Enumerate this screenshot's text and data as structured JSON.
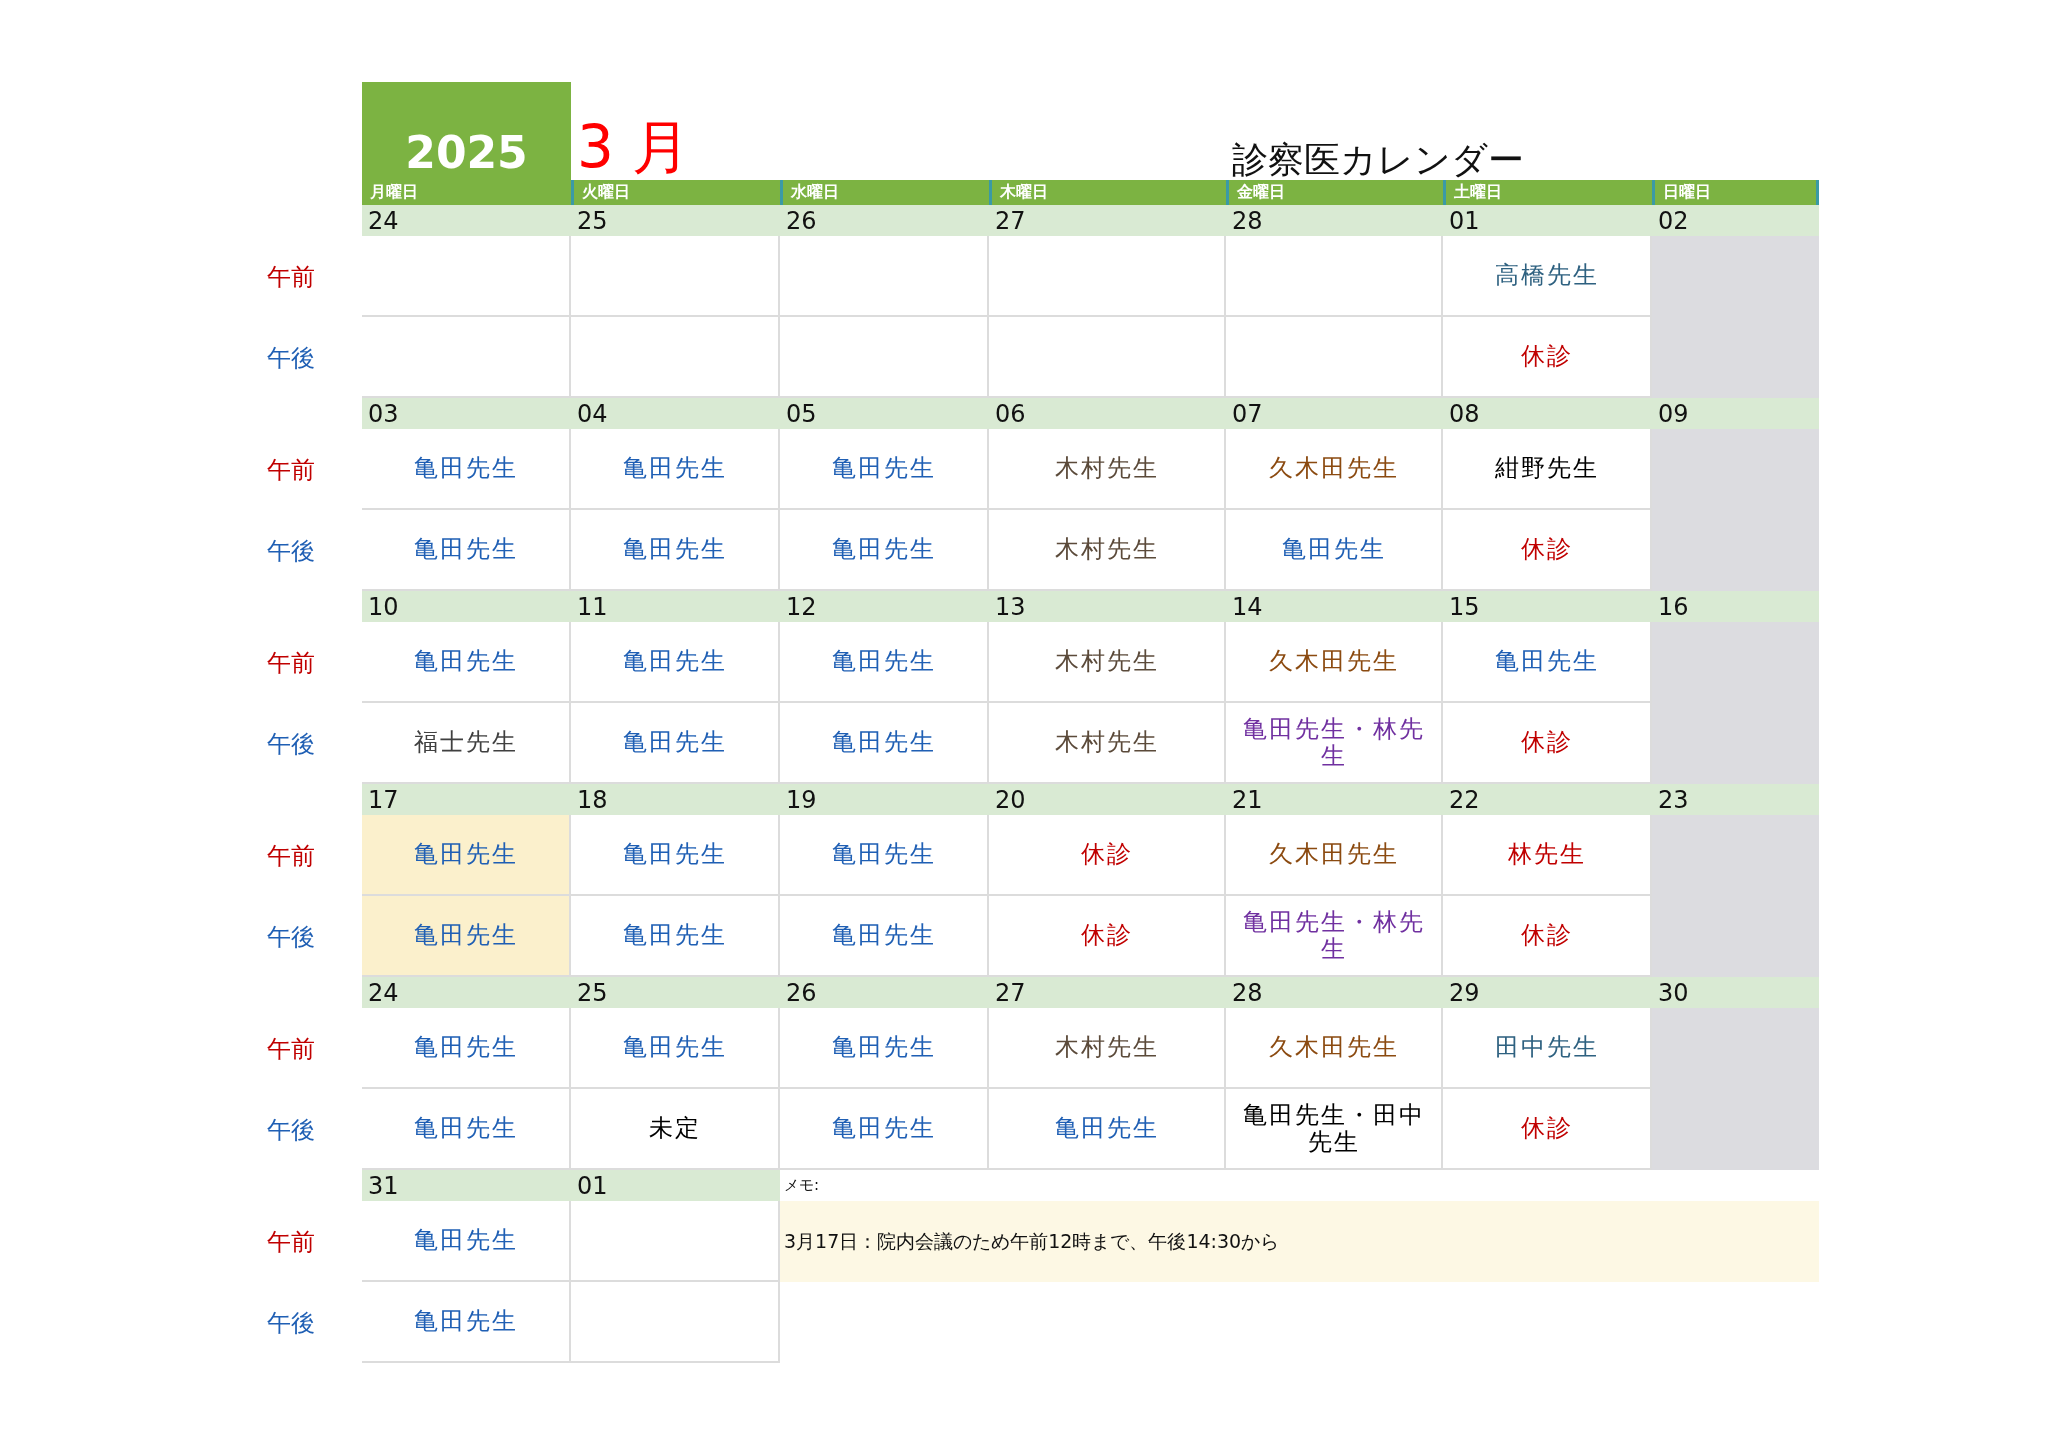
{
  "year": "2025",
  "month": "3 月",
  "title": "診察医カレンダー",
  "weekdays": [
    "月曜日",
    "火曜日",
    "水曜日",
    "木曜日",
    "金曜日",
    "土曜日",
    "日曜日"
  ],
  "weeks": [
    {
      "am_label": "午前",
      "pm_label": "午後",
      "days": [
        {
          "date": "24",
          "kind": "open",
          "highlighted": false
        },
        {
          "date": "25",
          "kind": "open",
          "highlighted": false
        },
        {
          "date": "26",
          "kind": "open",
          "highlighted": false
        },
        {
          "date": "27",
          "kind": "open",
          "highlighted": false
        },
        {
          "date": "28",
          "kind": "open",
          "highlighted": false
        },
        {
          "date": "01",
          "kind": "open",
          "highlighted": false,
          "am": {
            "text": "高橋先生",
            "color": "#2e6180"
          },
          "pm": {
            "text": "休診",
            "color": "#c00000"
          }
        },
        {
          "date": "02",
          "kind": "closed",
          "highlighted": false
        }
      ]
    },
    {
      "am_label": "午前",
      "pm_label": "午後",
      "days": [
        {
          "date": "03",
          "kind": "open",
          "highlighted": false,
          "am": {
            "text": "亀田先生",
            "color": "#1f5fb4"
          },
          "pm": {
            "text": "亀田先生",
            "color": "#1f5fb4"
          }
        },
        {
          "date": "04",
          "kind": "open",
          "highlighted": false,
          "am": {
            "text": "亀田先生",
            "color": "#1f5fb4"
          },
          "pm": {
            "text": "亀田先生",
            "color": "#1f5fb4"
          }
        },
        {
          "date": "05",
          "kind": "open",
          "highlighted": false,
          "am": {
            "text": "亀田先生",
            "color": "#1f5fb4"
          },
          "pm": {
            "text": "亀田先生",
            "color": "#1f5fb4"
          }
        },
        {
          "date": "06",
          "kind": "open",
          "highlighted": false,
          "am": {
            "text": "木村先生",
            "color": "#5b4a3a"
          },
          "pm": {
            "text": "木村先生",
            "color": "#5b4a3a"
          }
        },
        {
          "date": "07",
          "kind": "open",
          "highlighted": false,
          "am": {
            "text": "久木田先生",
            "color": "#8b4a10"
          },
          "pm": {
            "text": "亀田先生",
            "color": "#1f5fb4"
          }
        },
        {
          "date": "08",
          "kind": "open",
          "highlighted": false,
          "am": {
            "text": "紺野先生",
            "color": "#000000"
          },
          "pm": {
            "text": "休診",
            "color": "#c00000"
          }
        },
        {
          "date": "09",
          "kind": "closed",
          "highlighted": false
        }
      ]
    },
    {
      "am_label": "午前",
      "pm_label": "午後",
      "days": [
        {
          "date": "10",
          "kind": "open",
          "highlighted": false,
          "am": {
            "text": "亀田先生",
            "color": "#1f5fb4"
          },
          "pm": {
            "text": "福士先生",
            "color": "#404040"
          }
        },
        {
          "date": "11",
          "kind": "open",
          "highlighted": false,
          "am": {
            "text": "亀田先生",
            "color": "#1f5fb4"
          },
          "pm": {
            "text": "亀田先生",
            "color": "#1f5fb4"
          }
        },
        {
          "date": "12",
          "kind": "open",
          "highlighted": false,
          "am": {
            "text": "亀田先生",
            "color": "#1f5fb4"
          },
          "pm": {
            "text": "亀田先生",
            "color": "#1f5fb4"
          }
        },
        {
          "date": "13",
          "kind": "open",
          "highlighted": false,
          "am": {
            "text": "木村先生",
            "color": "#5b4a3a"
          },
          "pm": {
            "text": "木村先生",
            "color": "#5b4a3a"
          }
        },
        {
          "date": "14",
          "kind": "open",
          "highlighted": false,
          "am": {
            "text": "久木田先生",
            "color": "#8b4a10"
          },
          "pm": {
            "text": "亀田先生・林先生",
            "color": "#7030a0"
          }
        },
        {
          "date": "15",
          "kind": "open",
          "highlighted": false,
          "am": {
            "text": "亀田先生",
            "color": "#1f5fb4"
          },
          "pm": {
            "text": "休診",
            "color": "#c00000"
          }
        },
        {
          "date": "16",
          "kind": "closed",
          "highlighted": false
        }
      ]
    },
    {
      "am_label": "午前",
      "pm_label": "午後",
      "days": [
        {
          "date": "17",
          "kind": "open",
          "highlighted": true,
          "am": {
            "text": "亀田先生",
            "color": "#1f5fb4"
          },
          "pm": {
            "text": "亀田先生",
            "color": "#1f5fb4"
          }
        },
        {
          "date": "18",
          "kind": "open",
          "highlighted": false,
          "am": {
            "text": "亀田先生",
            "color": "#1f5fb4"
          },
          "pm": {
            "text": "亀田先生",
            "color": "#1f5fb4"
          }
        },
        {
          "date": "19",
          "kind": "open",
          "highlighted": false,
          "am": {
            "text": "亀田先生",
            "color": "#1f5fb4"
          },
          "pm": {
            "text": "亀田先生",
            "color": "#1f5fb4"
          }
        },
        {
          "date": "20",
          "kind": "open",
          "highlighted": false,
          "am": {
            "text": "休診",
            "color": "#c00000"
          },
          "pm": {
            "text": "休診",
            "color": "#c00000"
          }
        },
        {
          "date": "21",
          "kind": "open",
          "highlighted": false,
          "am": {
            "text": "久木田先生",
            "color": "#8b4a10"
          },
          "pm": {
            "text": "亀田先生・林先生",
            "color": "#7030a0"
          }
        },
        {
          "date": "22",
          "kind": "open",
          "highlighted": false,
          "am": {
            "text": "林先生",
            "color": "#c00000"
          },
          "pm": {
            "text": "休診",
            "color": "#c00000"
          }
        },
        {
          "date": "23",
          "kind": "closed",
          "highlighted": false
        }
      ]
    },
    {
      "am_label": "午前",
      "pm_label": "午後",
      "days": [
        {
          "date": "24",
          "kind": "open",
          "highlighted": false,
          "am": {
            "text": "亀田先生",
            "color": "#1f5fb4"
          },
          "pm": {
            "text": "亀田先生",
            "color": "#1f5fb4"
          }
        },
        {
          "date": "25",
          "kind": "open",
          "highlighted": false,
          "am": {
            "text": "亀田先生",
            "color": "#1f5fb4"
          },
          "pm": {
            "text": "未定",
            "color": "#000000"
          }
        },
        {
          "date": "26",
          "kind": "open",
          "highlighted": false,
          "am": {
            "text": "亀田先生",
            "color": "#1f5fb4"
          },
          "pm": {
            "text": "亀田先生",
            "color": "#1f5fb4"
          }
        },
        {
          "date": "27",
          "kind": "open",
          "highlighted": false,
          "am": {
            "text": "木村先生",
            "color": "#5b4a3a"
          },
          "pm": {
            "text": "亀田先生",
            "color": "#1f5fb4"
          }
        },
        {
          "date": "28",
          "kind": "open",
          "highlighted": false,
          "am": {
            "text": "久木田先生",
            "color": "#8b4a10"
          },
          "pm": {
            "text": "亀田先生・田中先生",
            "color": "#000000"
          }
        },
        {
          "date": "29",
          "kind": "open",
          "highlighted": false,
          "am": {
            "text": "田中先生",
            "color": "#2e6180"
          },
          "pm": {
            "text": "休診",
            "color": "#c00000"
          }
        },
        {
          "date": "30",
          "kind": "closed",
          "highlighted": false
        }
      ]
    },
    {
      "am_label": "午前",
      "pm_label": "午後",
      "days": [
        {
          "date": "31",
          "kind": "open",
          "highlighted": false,
          "am": {
            "text": "亀田先生",
            "color": "#1f5fb4"
          },
          "pm": {
            "text": "亀田先生",
            "color": "#1f5fb4"
          }
        },
        {
          "date": "01",
          "kind": "open",
          "highlighted": false
        }
      ],
      "memo": {
        "label": "メモ:",
        "text": "3月17日：院内会議のため午前12時まで、午後14:30から"
      }
    }
  ]
}
